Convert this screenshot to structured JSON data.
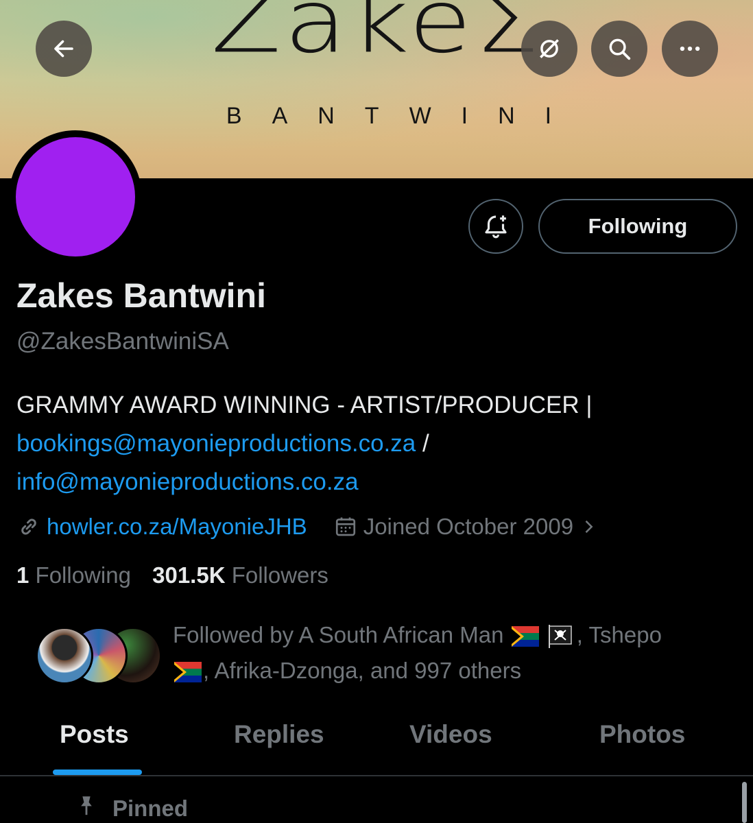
{
  "banner": {
    "logo_text": "ZakeΣ",
    "subtitle": "BANTWINI"
  },
  "header": {
    "back_icon": "arrow-left-icon",
    "grok_icon": "grok-icon",
    "search_icon": "search-icon",
    "more_icon": "more-icon"
  },
  "profile": {
    "avatar_color": "#a020f0",
    "notify_icon": "bell-plus-icon",
    "following_label": "Following",
    "name": "Zakes Bantwini",
    "handle": "@ZakesBantwiniSA",
    "bio_text": "GRAMMY AWARD WINNING - ARTIST/PRODUCER |",
    "bio_email1": "bookings@mayonieproductions.co.za",
    "bio_sep": "/",
    "bio_email2": "info@mayonieproductions.co.za",
    "website": "howler.co.za/MayonieJHB",
    "joined": "Joined October 2009",
    "following_count": "1",
    "following_word": "Following",
    "followers_count": "301.5K",
    "followers_word": "Followers",
    "followed_by_line1": "Followed by A South African Man",
    "followed_by_line1b": ", Tshepo",
    "followed_by_line2": ", Afrika-Dzonga, and 997 others"
  },
  "tabs": [
    {
      "label": "Posts"
    },
    {
      "label": "Replies"
    },
    {
      "label": "Videos"
    },
    {
      "label": "Photos"
    }
  ],
  "pinned_label": "Pinned",
  "colors": {
    "accent": "#1d9bf0",
    "background": "#000000",
    "muted": "#71767b"
  }
}
